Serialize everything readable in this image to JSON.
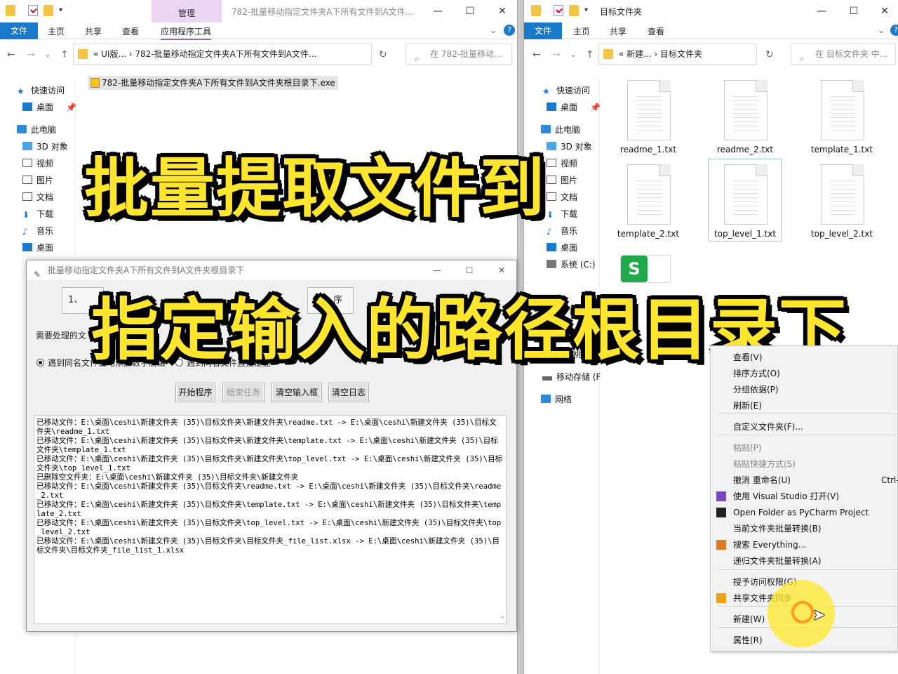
{
  "left_window": {
    "title": "782-批量移动指定文件夹A下所有文件到A文件...",
    "context_tab": "管理",
    "ribbon_tabs": [
      "文件",
      "主页",
      "共享",
      "查看",
      "应用程序工具"
    ],
    "address": "« UI版...  ›  782-批量移动指定文件夹A下所有文件到A文件...",
    "search_placeholder": "在 782-批量移动...",
    "nav": [
      "快速访问",
      "桌面",
      "此电脑",
      "3D 对象",
      "视频",
      "图片",
      "文档",
      "下载",
      "音乐",
      "桌面"
    ],
    "file": "782-批量移动指定文件夹A下所有文件到A文件夹根目录下.exe"
  },
  "right_window": {
    "title": "目标文件夹",
    "ribbon_tabs": [
      "文件",
      "主页",
      "共享",
      "查看"
    ],
    "address": "« 新建...  ›  目标文件夹",
    "search_placeholder": "在 目标文件夹 中...",
    "nav": [
      "快速访问",
      "桌面",
      "此电脑",
      "3D 对象",
      "视频",
      "图片",
      "文档",
      "下载",
      "音乐",
      "桌面",
      "系统 (C:)",
      "老毛桃U盘",
      "移动存储 (F",
      "网络"
    ],
    "files": [
      "readme_1.txt",
      "readme_2.txt",
      "template_1.txt",
      "template_2.txt",
      "top_level_1.txt",
      "top_level_2.txt"
    ]
  },
  "overlay": {
    "line1": "批量提取文件到",
    "line2": "指定输入的路径根目录下"
  },
  "dialog": {
    "title": "批量移动指定文件夹A下所有文件到A文件夹根目录下",
    "step_label": "1、",
    "step_label_end": "序",
    "path_label": "需要处理的文",
    "radio1": "遇到同名文件自动添加数字后缀",
    "radio2": "遇到同名文件直接覆盖",
    "buttons": {
      "start": "开始程序",
      "stop": "结束任务",
      "clear_input": "清空输入框",
      "clear_log": "清空日志"
    },
    "log": [
      "已移动文件：E:\\桌面\\ceshi\\新建文件夹 (35)\\目标文件夹\\新建文件夹\\readme.txt -> E:\\桌面\\ceshi\\新建文件夹 (35)\\目标文件夹\\readme_1.txt",
      "已移动文件：E:\\桌面\\ceshi\\新建文件夹 (35)\\目标文件夹\\新建文件夹\\template.txt -> E:\\桌面\\ceshi\\新建文件夹 (35)\\目标文件夹\\template_1.txt",
      "已移动文件：E:\\桌面\\ceshi\\新建文件夹 (35)\\目标文件夹\\新建文件夹\\top_level.txt -> E:\\桌面\\ceshi\\新建文件夹 (35)\\目标文件夹\\top_level_1.txt",
      "已删除空文件夹：E:\\桌面\\ceshi\\新建文件夹 (35)\\目标文件夹\\新建文件夹",
      "已移动文件：E:\\桌面\\ceshi\\新建文件夹 (35)\\目标文件夹\\readme.txt -> E:\\桌面\\ceshi\\新建文件夹 (35)\\目标文件夹\\readme_2.txt",
      "已移动文件：E:\\桌面\\ceshi\\新建文件夹 (35)\\目标文件夹\\template.txt -> E:\\桌面\\ceshi\\新建文件夹 (35)\\目标文件夹\\template_2.txt",
      "已移动文件：E:\\桌面\\ceshi\\新建文件夹 (35)\\目标文件夹\\top_level.txt -> E:\\桌面\\ceshi\\新建文件夹 (35)\\目标文件夹\\top_level_2.txt",
      "已移动文件：E:\\桌面\\ceshi\\新建文件夹 (35)\\目标文件夹\\目标文件夹_file_list.xlsx -> E:\\桌面\\ceshi\\新建文件夹 (35)\\目标文件夹\\目标文件夹_file_list_1.xlsx"
    ]
  },
  "context_menu": {
    "items": [
      "查看(V)",
      "排序方式(O)",
      "分组依据(P)",
      "刷新(E)",
      "自定义文件夹(F)...",
      "粘贴(P)",
      "粘贴快捷方式(S)",
      "撤消 重命名(U)",
      "使用 Visual Studio 打开(V)",
      "Open Folder as PyCharm Project",
      "当前文件夹批量转换(B)",
      "搜索 Everything...",
      "递归文件夹批量转换(A)",
      "授予访问权限(G)",
      "共享文件夹同步",
      "新建(W)",
      "属性(R)"
    ],
    "undo_shortcut": "Ctrl-"
  },
  "colors": {
    "ribbon_file": "#1979ca",
    "overlay_fill": "#ffe62e",
    "context_tab": "#ead6f2"
  }
}
